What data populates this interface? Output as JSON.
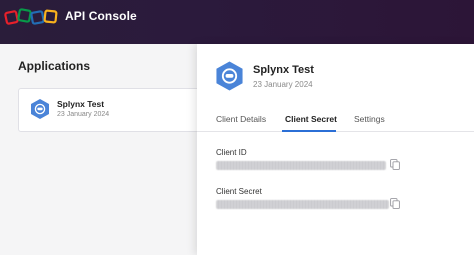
{
  "header": {
    "title": "API Console",
    "logo_colors": [
      "#e8202a",
      "#089949",
      "#226db4",
      "#f9b21d"
    ]
  },
  "applications": {
    "title": "Applications",
    "items": [
      {
        "name": "Splynx Test",
        "date": "23 January 2024",
        "icon": "splynx-hex-icon"
      }
    ]
  },
  "details": {
    "name": "Splynx Test",
    "date": "23 January 2024",
    "icon": "splynx-hex-icon",
    "tabs": [
      {
        "label": "Client Details",
        "active": false
      },
      {
        "label": "Client Secret",
        "active": true
      },
      {
        "label": "Settings",
        "active": false
      }
    ],
    "fields": [
      {
        "label": "Client ID",
        "value_masked": true,
        "copy_icon": "copy-icon"
      },
      {
        "label": "Client Secret",
        "value_masked": true,
        "copy_icon": "copy-icon"
      }
    ]
  },
  "colors": {
    "header_bg": "#2a1d3a",
    "accent": "#2b6fd6",
    "hex_fill": "#4a84d8"
  }
}
